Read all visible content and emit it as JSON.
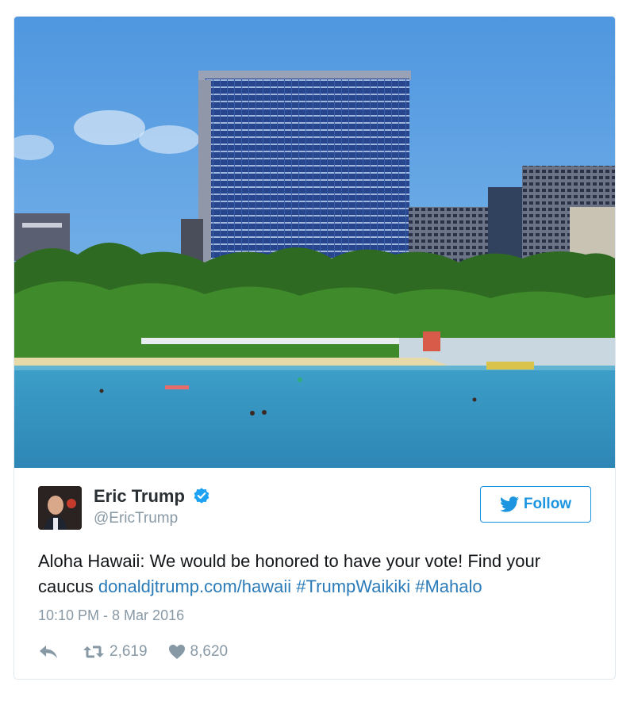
{
  "tweet": {
    "author": {
      "display_name": "Eric Trump",
      "handle": "@EricTrump",
      "verified": true
    },
    "follow_label": "Follow",
    "text_plain": "Aloha Hawaii: We would be honored to have your vote! Find your caucus ",
    "links": {
      "url": "donaldjtrump.com/hawaii",
      "hashtag1": "#TrumpWaikiki",
      "hashtag2": "#Mahalo"
    },
    "timestamp": "10:10 PM - 8 Mar 2016",
    "stats": {
      "retweets": "2,619",
      "likes": "8,620"
    }
  },
  "icons": {
    "reply": "reply-icon",
    "retweet": "retweet-icon",
    "like": "heart-icon",
    "verified": "verified-badge-icon",
    "follow": "twitter-bird-icon"
  },
  "colors": {
    "link": "#2b7bb9",
    "follow_accent": "#1b95e0",
    "muted": "#8899a6"
  }
}
